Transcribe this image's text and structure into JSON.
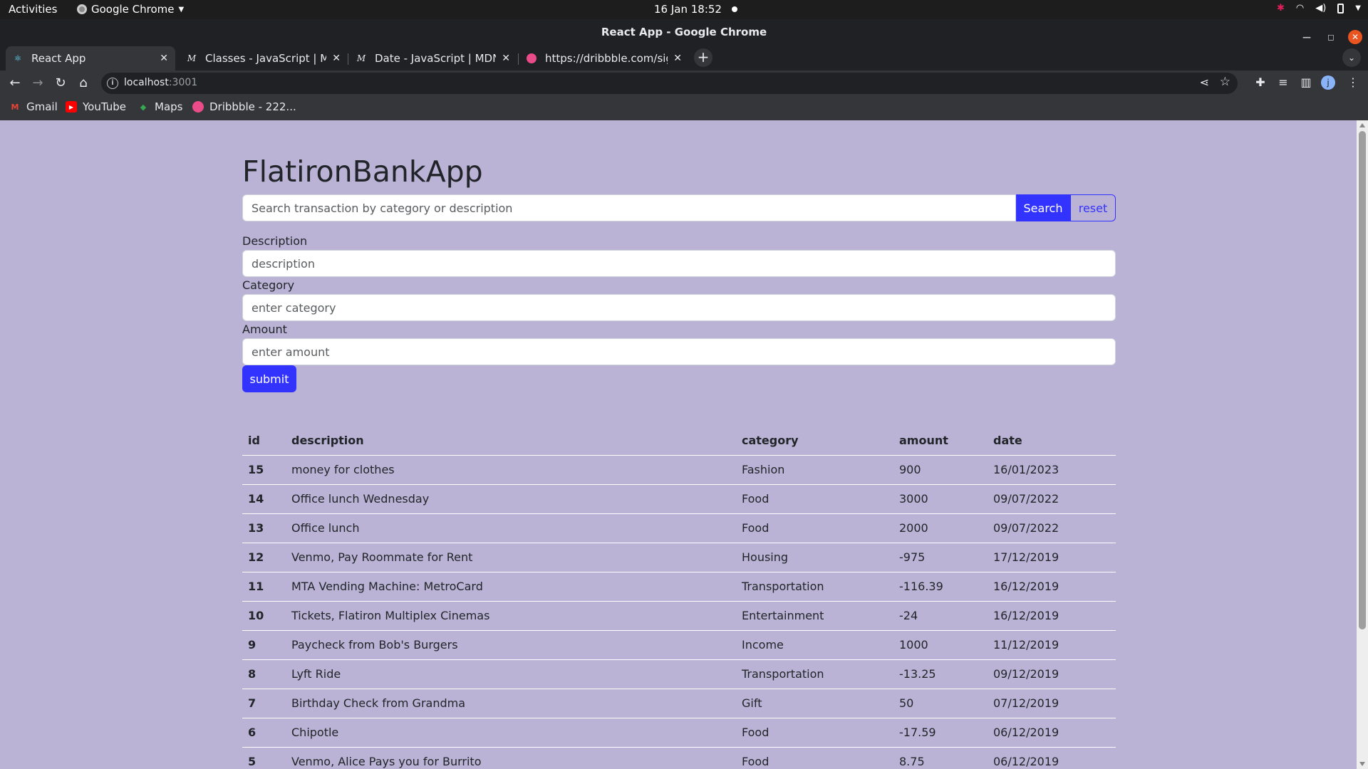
{
  "os": {
    "activities": "Activities",
    "app_menu": "Google Chrome",
    "clock": "16 Jan  18:52"
  },
  "window": {
    "title": "React App - Google Chrome"
  },
  "tabs": [
    {
      "label": "React App",
      "icon": "react-icon"
    },
    {
      "label": "Classes - JavaScript | MDN",
      "icon": "mdn-icon"
    },
    {
      "label": "Date - JavaScript | MDN",
      "icon": "mdn-icon"
    },
    {
      "label": "https://dribbble.com/signup",
      "icon": "dribbble-icon"
    }
  ],
  "address": {
    "host": "localhost",
    "port": ":3001"
  },
  "bookmarks": [
    {
      "label": "Gmail",
      "icon": "gmail-icon"
    },
    {
      "label": "YouTube",
      "icon": "youtube-icon"
    },
    {
      "label": "Maps",
      "icon": "maps-icon"
    },
    {
      "label": "Dribbble - 222...",
      "icon": "dribbble-icon"
    }
  ],
  "profile_initial": "j",
  "page": {
    "title": "FlatironBankApp",
    "search": {
      "placeholder": "Search transaction by category or description",
      "search_label": "Search",
      "reset_label": "reset"
    },
    "form": {
      "description_label": "Description",
      "description_placeholder": "description",
      "category_label": "Category",
      "category_placeholder": "enter category",
      "amount_label": "Amount",
      "amount_placeholder": "enter amount",
      "submit_label": "submit"
    },
    "table": {
      "headers": [
        "id",
        "description",
        "category",
        "amount",
        "date"
      ],
      "rows": [
        [
          "15",
          "money for clothes",
          "Fashion",
          "900",
          "16/01/2023"
        ],
        [
          "14",
          "Office lunch Wednesday",
          "Food",
          "3000",
          "09/07/2022"
        ],
        [
          "13",
          "Office lunch",
          "Food",
          "2000",
          "09/07/2022"
        ],
        [
          "12",
          "Venmo, Pay Roommate for Rent",
          "Housing",
          "-975",
          "17/12/2019"
        ],
        [
          "11",
          "MTA Vending Machine: MetroCard",
          "Transportation",
          "-116.39",
          "16/12/2019"
        ],
        [
          "10",
          "Tickets, Flatiron Multiplex Cinemas",
          "Entertainment",
          "-24",
          "16/12/2019"
        ],
        [
          "9",
          "Paycheck from Bob's Burgers",
          "Income",
          "1000",
          "11/12/2019"
        ],
        [
          "8",
          "Lyft Ride",
          "Transportation",
          "-13.25",
          "09/12/2019"
        ],
        [
          "7",
          "Birthday Check from Grandma",
          "Gift",
          "50",
          "07/12/2019"
        ],
        [
          "6",
          "Chipotle",
          "Food",
          "-17.59",
          "06/12/2019"
        ],
        [
          "5",
          "Venmo, Alice Pays you for Burrito",
          "Food",
          "8.75",
          "06/12/2019"
        ]
      ]
    }
  },
  "colors": {
    "page_background": "#bab3d5",
    "accent": "#3333ff",
    "chrome_dark": "#202124",
    "chrome_toolbar": "#35363a"
  }
}
